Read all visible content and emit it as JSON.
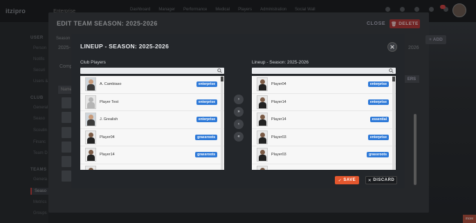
{
  "app": {
    "logo": "itzipro",
    "org": "Enterprise",
    "nav": [
      "Dashboard",
      "Manager",
      "Performance",
      "Medical",
      "Players",
      "Administration",
      "Social Wall"
    ],
    "sidebar": {
      "user_head": "USER",
      "user_items": [
        "Person",
        "Notific",
        "Securi",
        "Users &"
      ],
      "club_head": "CLUB",
      "club_items": [
        "General",
        "Seaso",
        "Scoutin",
        "Financ",
        "Team D"
      ],
      "teams_head": "TEAMS",
      "teams_items": [
        "Genera",
        "Seaso",
        "Metrics",
        "Groups"
      ]
    },
    "corner_label": "more"
  },
  "edit_modal": {
    "title": "EDIT TEAM SEASON: 2025-2026",
    "close": "CLOSE",
    "delete": "DELETE",
    "season_label": "Season",
    "season_value": "2025-",
    "tab": "Comp",
    "table_head": "Name",
    "add": "ADD",
    "season_right": "2026",
    "players_btn": "ERS"
  },
  "lineup_modal": {
    "title": "LINEUP - SEASON: 2025-2026",
    "left_label": "Club Players",
    "right_label": "Lineup - Season: 2025-2026",
    "left_search": "",
    "right_search": "",
    "left_players": [
      {
        "name": "A. Cambiaso",
        "badge": "enterprise",
        "photo": "face"
      },
      {
        "name": "Player Test",
        "badge": "enterprise",
        "photo": "silhouette"
      },
      {
        "name": "J. Grealish",
        "badge": "enterprise",
        "photo": "face"
      },
      {
        "name": "Player04",
        "badge": "grassroots",
        "photo": "kit"
      },
      {
        "name": "Player14",
        "badge": "grassroots",
        "photo": "kit"
      },
      {
        "name": "",
        "badge": "",
        "photo": "kit"
      }
    ],
    "right_players": [
      {
        "name": "Player04",
        "badge": "enterprise",
        "photo": "kit"
      },
      {
        "name": "Player14",
        "badge": "enterprise",
        "photo": "kit"
      },
      {
        "name": "Player14",
        "badge": "essential",
        "photo": "kit"
      },
      {
        "name": "Player03",
        "badge": "enterprise",
        "photo": "kit"
      },
      {
        "name": "Player03",
        "badge": "grassroots",
        "photo": "kit"
      },
      {
        "name": "",
        "badge": "",
        "photo": "kit"
      }
    ],
    "move_buttons": [
      "›",
      "»",
      "‹",
      "«"
    ],
    "save": "SAVE",
    "discard": "DISCARD"
  },
  "colors": {
    "badge_blue": "#2f7ad8",
    "save_orange": "#e4572e",
    "delete_red": "#b03a3a"
  }
}
